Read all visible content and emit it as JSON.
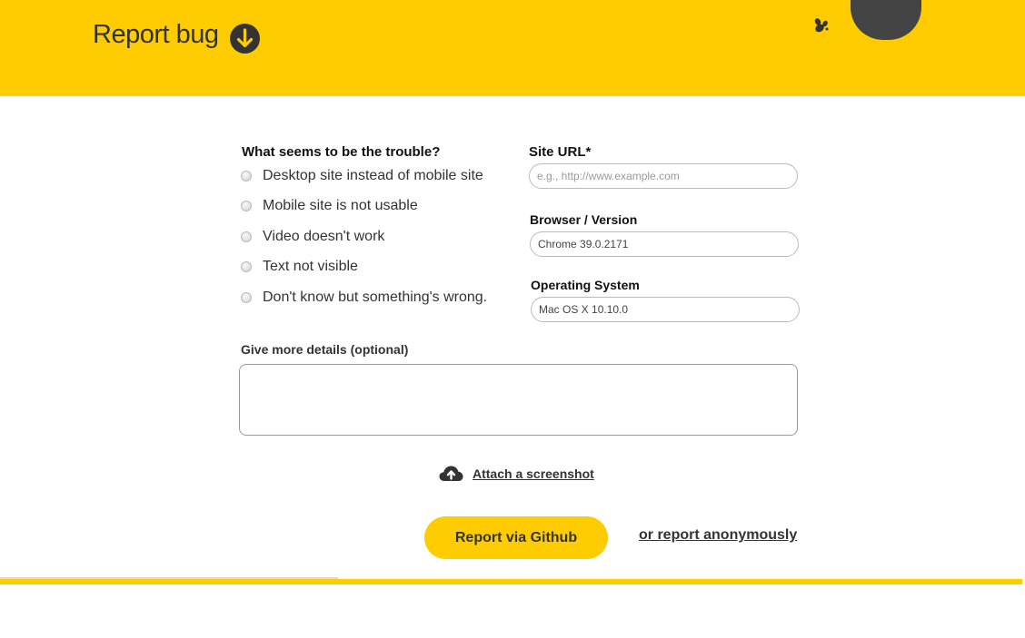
{
  "header": {
    "title": "Report bug",
    "icon": "arrow-down-circle-icon",
    "bug_icon": "bee-icon",
    "background": "#fecc00"
  },
  "trouble": {
    "heading": "What seems to be the trouble?",
    "options": [
      "Desktop site instead of mobile site",
      "Mobile site is not usable",
      "Video doesn't work",
      "Text not visible",
      "Don't know but something's wrong."
    ]
  },
  "site_url": {
    "label": "Site URL*",
    "placeholder": "e.g., http://www.example.com",
    "value": ""
  },
  "browser": {
    "label": "Browser / Version",
    "value": "Chrome 39.0.2171"
  },
  "os": {
    "label": "Operating System",
    "value": "Mac OS X 10.10.0"
  },
  "details": {
    "label": "Give more details (optional)",
    "value": ""
  },
  "attach": {
    "label": "Attach a screenshot",
    "icon": "cloud-upload-icon"
  },
  "actions": {
    "github_label": "Report via Github",
    "anonymous_label": "or report anonymously"
  },
  "colors": {
    "accent": "#fecc00",
    "text": "#333333"
  }
}
